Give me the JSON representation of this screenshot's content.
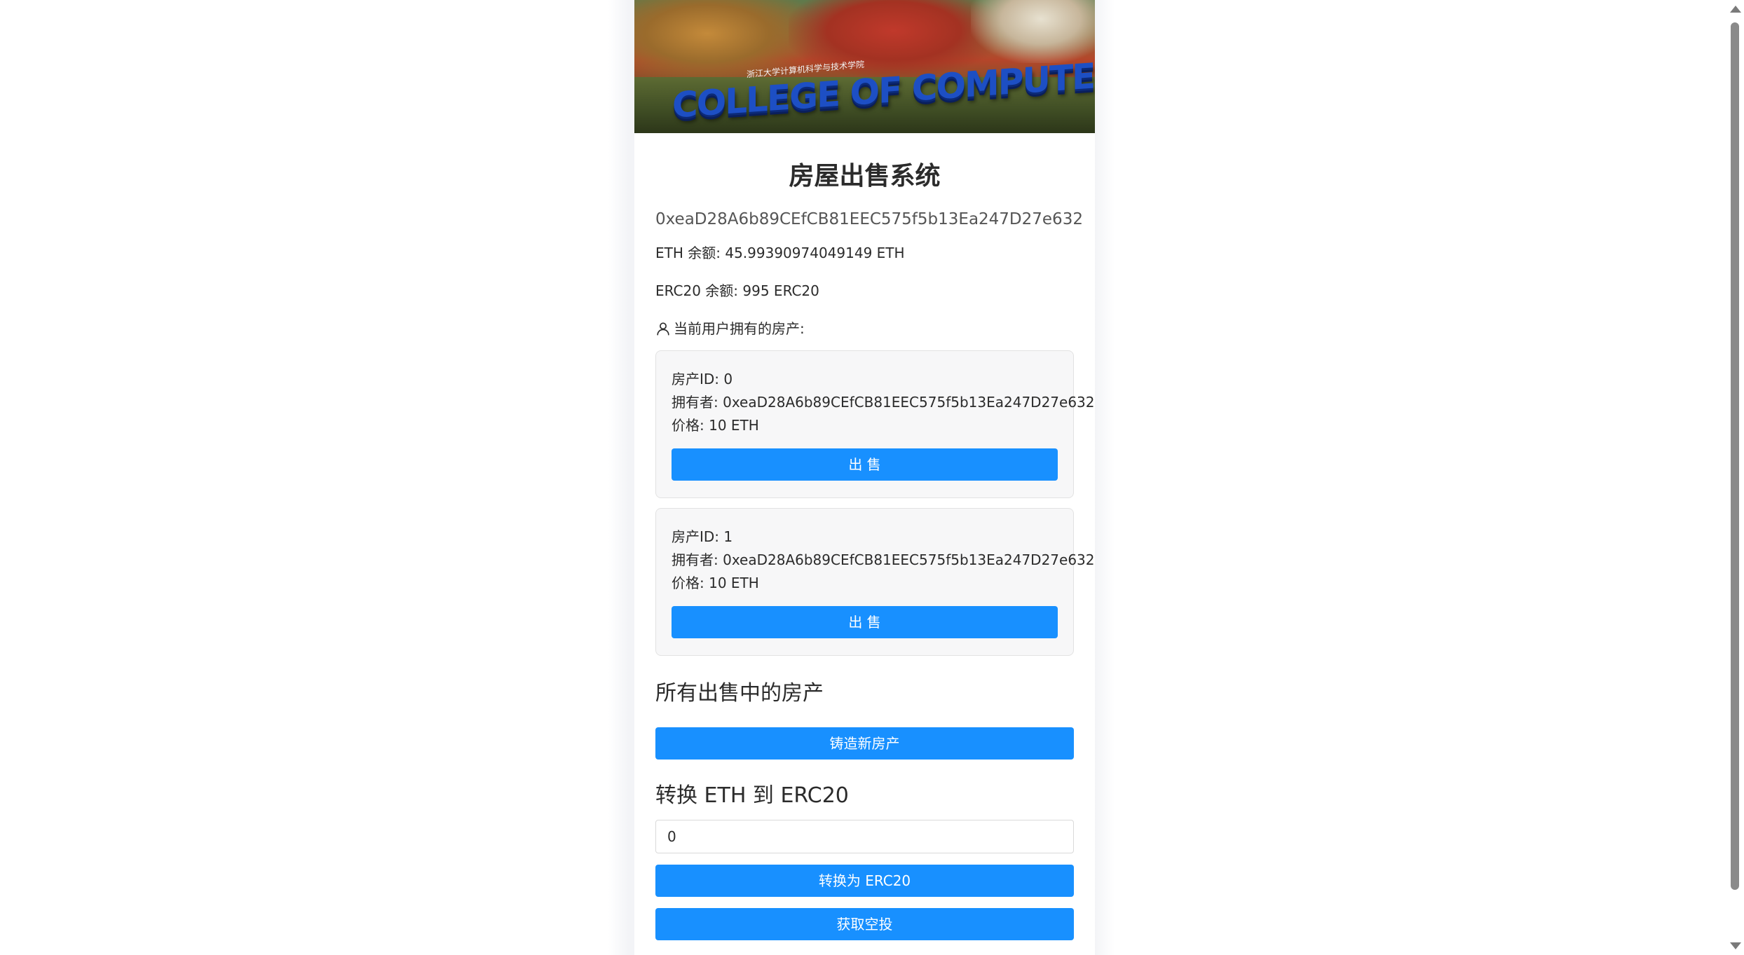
{
  "app": {
    "title": "房屋出售系统",
    "banner_sign": "COLLEGE OF COMPUTER SCIENCE",
    "banner_subtitle": "浙江大学计算机科学与技术学院"
  },
  "account": {
    "address": "0xeaD28A6b89CEfCB81EEC575f5b13Ea247D27e632",
    "eth_balance": "ETH 余额: 45.99390974049149 ETH",
    "erc20_balance": "ERC20 余额: 995 ERC20"
  },
  "owned": {
    "label": "当前用户拥有的房产:",
    "icon": "user-icon",
    "properties": [
      {
        "id_text": "房产ID: 0",
        "owner_text": "拥有者: 0xeaD28A6b89CEfCB81EEC575f5b13Ea247D27e632",
        "price_text": "价格: 10 ETH",
        "sell_label": "出 售"
      },
      {
        "id_text": "房产ID: 1",
        "owner_text": "拥有者: 0xeaD28A6b89CEfCB81EEC575f5b13Ea247D27e632",
        "price_text": "价格: 10 ETH",
        "sell_label": "出 售"
      }
    ]
  },
  "market": {
    "title": "所有出售中的房产",
    "mint_label": "铸造新房产"
  },
  "convert": {
    "title": "转换 ETH 到 ERC20",
    "amount_value": "0",
    "convert_label": "转换为 ERC20",
    "airdrop_label": "获取空投"
  },
  "colors": {
    "primary": "#1890ff",
    "card_bg": "#f7f7f8",
    "card_border": "#e2e2e2"
  }
}
